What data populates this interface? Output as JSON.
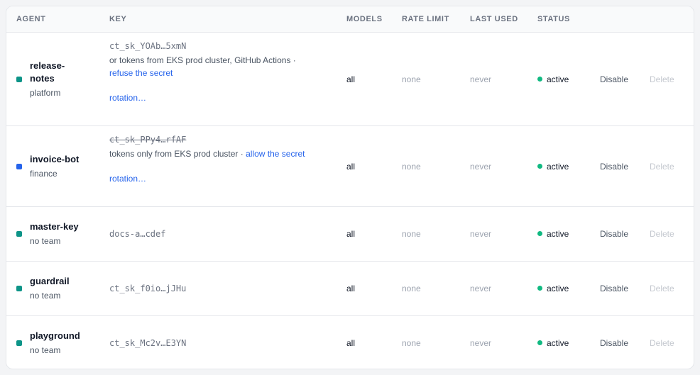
{
  "colors": {
    "accent_link": "#2563eb",
    "status_active": "#10b981"
  },
  "headers": {
    "agent": "AGENT",
    "key": "KEY",
    "models": "MODELS",
    "rate_limit": "RATE LIMIT",
    "last_used": "LAST USED",
    "status": "STATUS"
  },
  "rows": [
    {
      "name": "release-notes",
      "team": "platform",
      "team_color": "#0d9488",
      "key": "ct_sk_YOAb…5xmN",
      "note_text": "or tokens from EKS prod cluster, GitHub Actions ·",
      "note_link": "refuse the secret",
      "rotation": "rotation…",
      "models": "all",
      "rate_limit": "none",
      "last_used": "never",
      "status": "active",
      "disable": "Disable",
      "delete": "Delete"
    },
    {
      "name": "invoice-bot",
      "team": "finance",
      "team_color": "#2563eb",
      "key": "ct_sk_PPy4…rfAF",
      "note_text": "tokens only from EKS prod cluster ·",
      "note_link": "allow the secret",
      "rotation": "rotation…",
      "models": "all",
      "rate_limit": "none",
      "last_used": "never",
      "status": "active",
      "disable": "Disable",
      "delete": "Delete"
    },
    {
      "name": "master-key",
      "team": "no team",
      "team_color": "#0d9488",
      "key": "docs-a…cdef",
      "models": "all",
      "rate_limit": "none",
      "last_used": "never",
      "status": "active",
      "disable": "Disable",
      "delete": "Delete"
    },
    {
      "name": "guardrail",
      "team": "no team",
      "team_color": "#0d9488",
      "key": "ct_sk_f0io…jJHu",
      "models": "all",
      "rate_limit": "none",
      "last_used": "never",
      "status": "active",
      "disable": "Disable",
      "delete": "Delete"
    },
    {
      "name": "playground",
      "team": "no team",
      "team_color": "#0d9488",
      "key": "ct_sk_Mc2v…E3YN",
      "models": "all",
      "rate_limit": "none",
      "last_used": "never",
      "status": "active",
      "disable": "Disable",
      "delete": "Delete"
    }
  ]
}
